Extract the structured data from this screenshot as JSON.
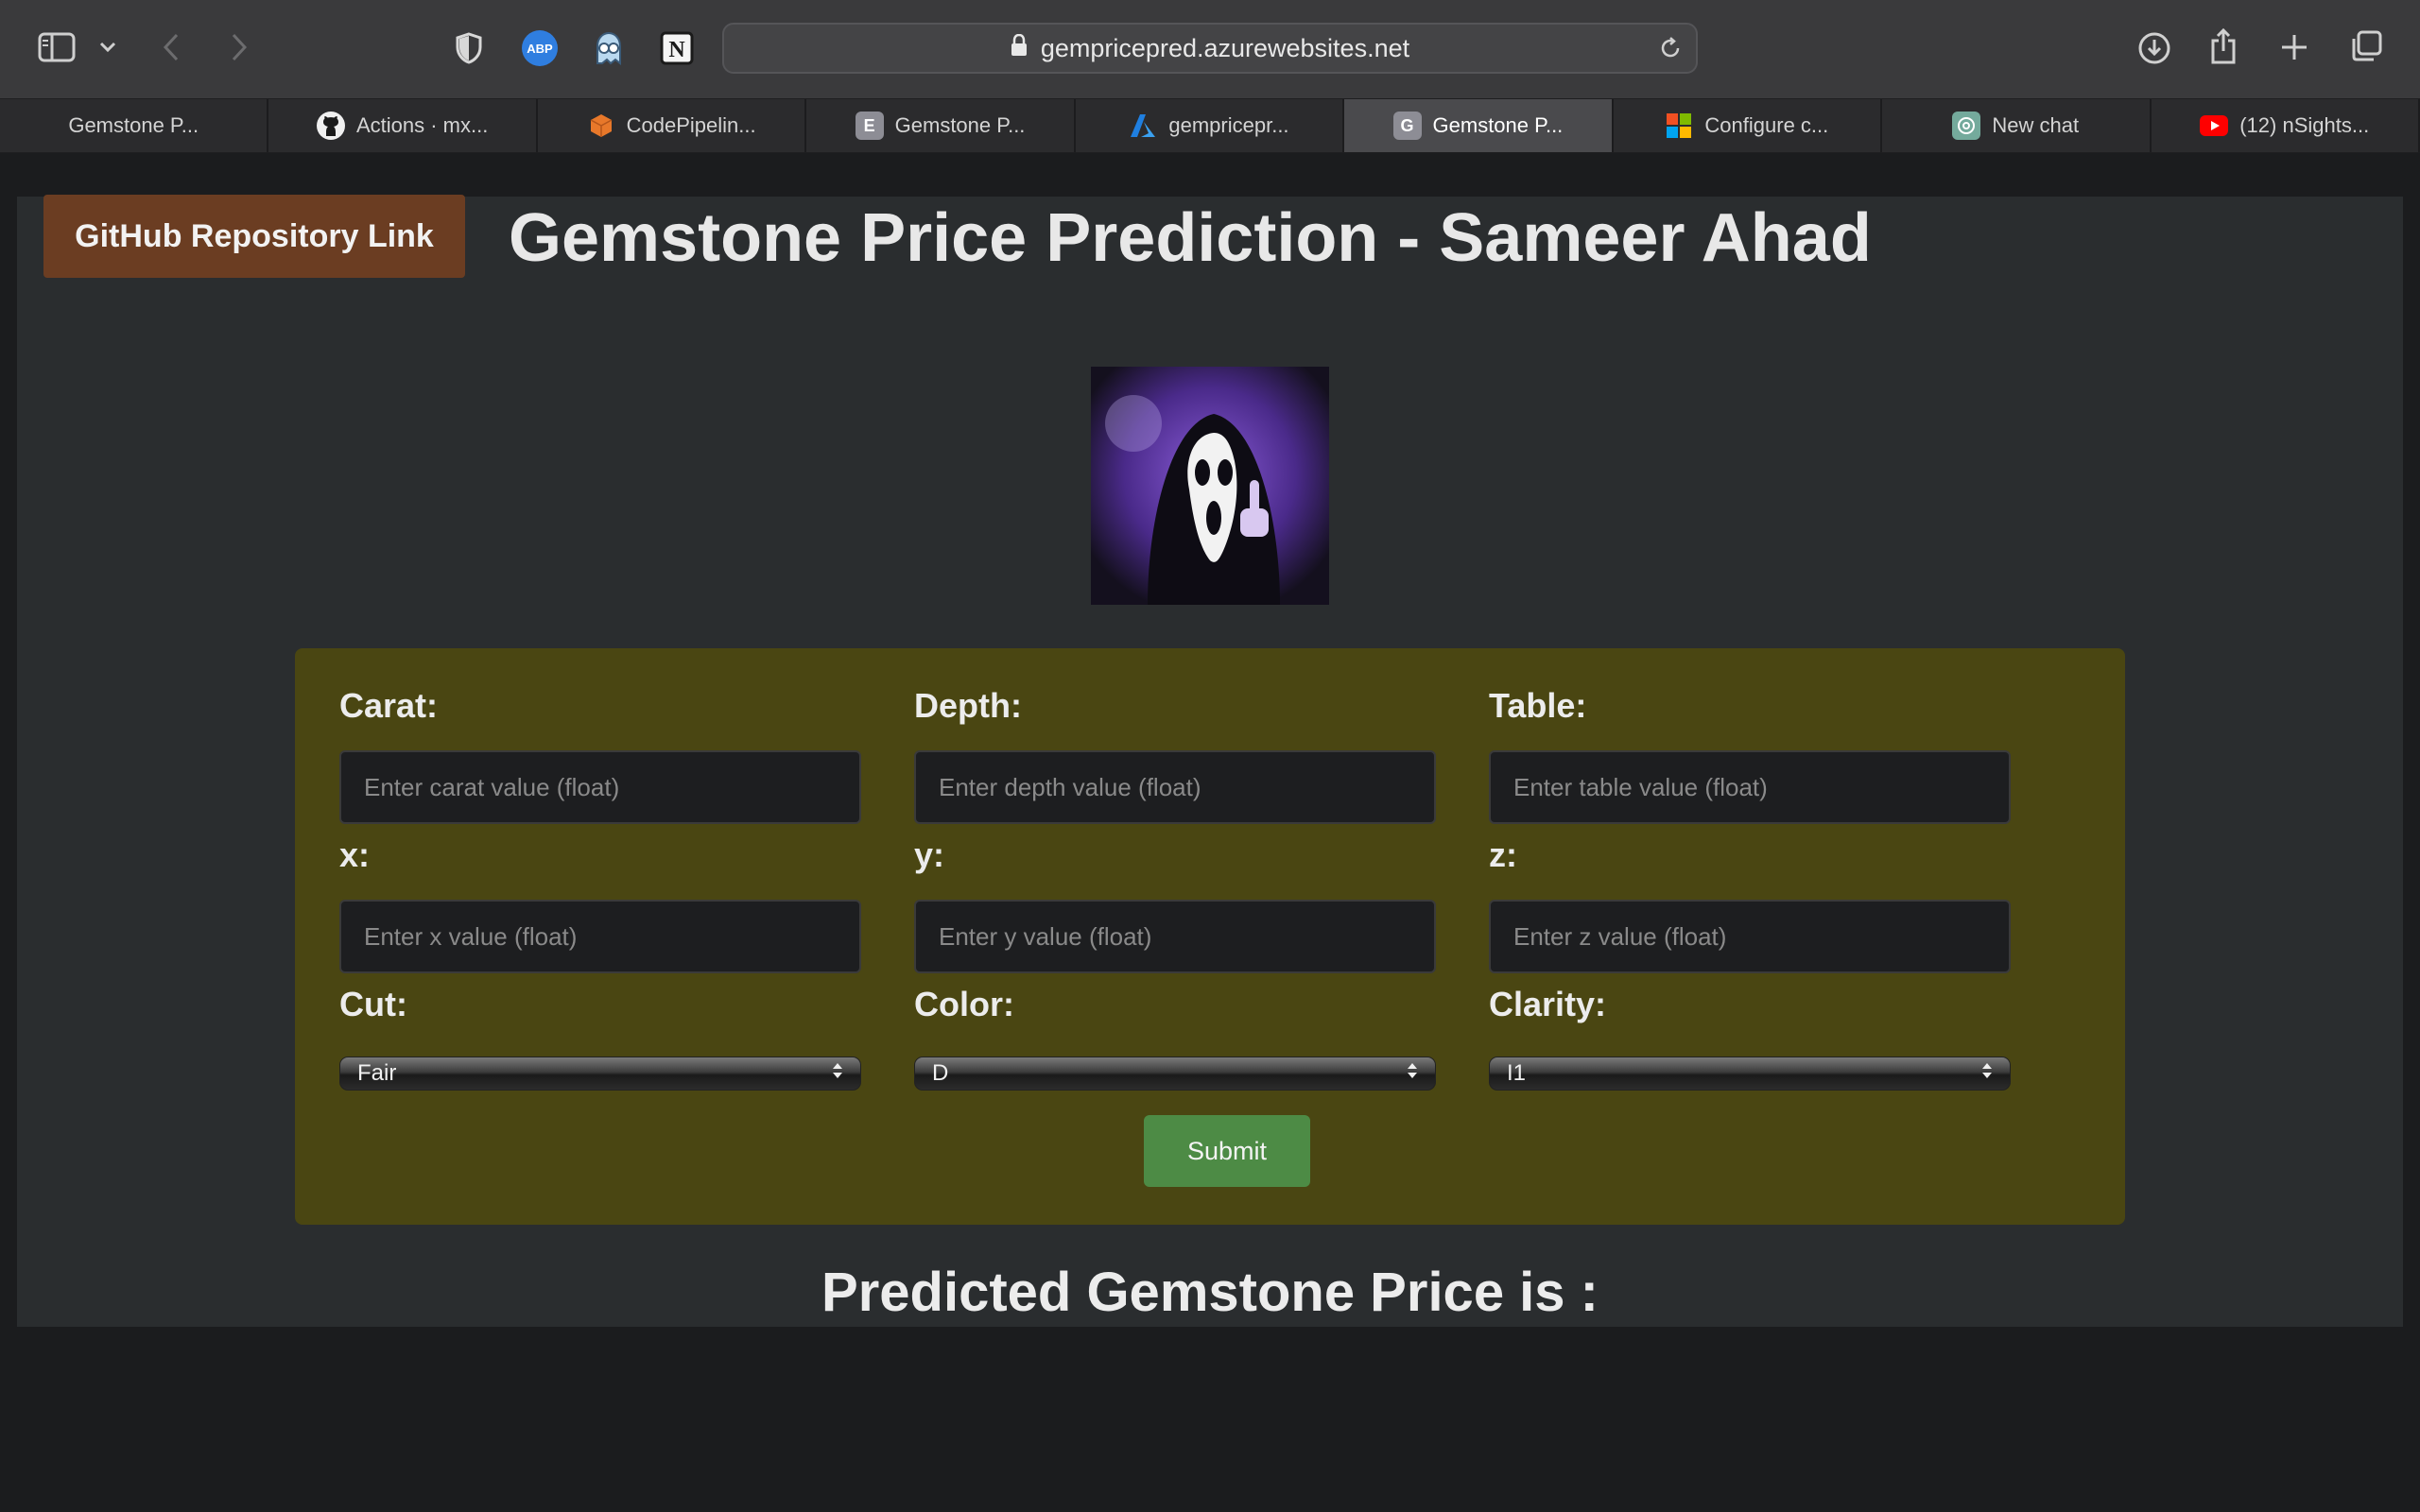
{
  "browser": {
    "url": "gempricepred.azurewebsites.net",
    "tabs": [
      {
        "label": "Gemstone P...",
        "favicon": "none"
      },
      {
        "label": "Actions · mx...",
        "favicon": "github-icon"
      },
      {
        "label": "CodePipelin...",
        "favicon": "aws-codepipeline-icon"
      },
      {
        "label": "Gemstone P...",
        "favicon": "letter-e-icon",
        "favicon_text": "E"
      },
      {
        "label": "gempricepr...",
        "favicon": "azure-icon"
      },
      {
        "label": "Gemstone P...",
        "favicon": "letter-g-icon",
        "favicon_text": "G",
        "active": true
      },
      {
        "label": "Configure c...",
        "favicon": "microsoft-icon"
      },
      {
        "label": "New chat",
        "favicon": "openai-icon"
      },
      {
        "label": "(12) nSights...",
        "favicon": "youtube-icon"
      }
    ],
    "extensions": [
      "privacy-shield-icon",
      "adblock-plus-icon",
      "ghost-icon",
      "notion-icon"
    ],
    "adblock_label": "ABP"
  },
  "page": {
    "github_button": "GitHub Repository Link",
    "title": "Gemstone Price Prediction - Sameer Ahad",
    "form": {
      "carat": {
        "label": "Carat:",
        "placeholder": "Enter carat value (float)"
      },
      "depth": {
        "label": "Depth:",
        "placeholder": "Enter depth value (float)"
      },
      "table": {
        "label": "Table:",
        "placeholder": "Enter table value (float)"
      },
      "x": {
        "label": "x:",
        "placeholder": "Enter x value (float)"
      },
      "y": {
        "label": "y:",
        "placeholder": "Enter y value (float)"
      },
      "z": {
        "label": "z:",
        "placeholder": "Enter z value (float)"
      },
      "cut": {
        "label": "Cut:",
        "selected": "Fair"
      },
      "color": {
        "label": "Color:",
        "selected": "D"
      },
      "clarity": {
        "label": "Clarity:",
        "selected": "I1"
      },
      "submit": "Submit"
    },
    "predicted_text": "Predicted Gemstone Price is :"
  },
  "colors": {
    "form_background": "#4a4612",
    "github_button": "#6b3d22",
    "submit_button": "#4d8b45",
    "page_background": "#2a2d2f"
  }
}
